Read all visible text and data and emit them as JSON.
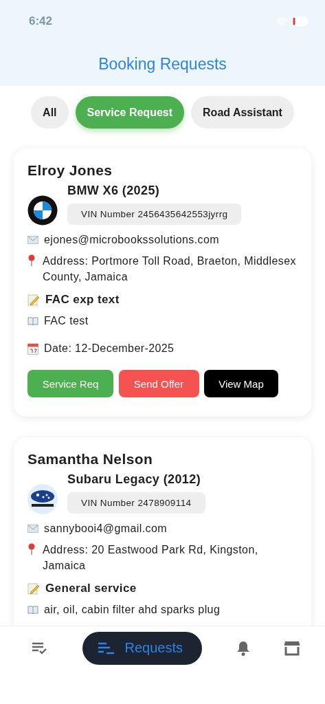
{
  "status_bar": {
    "time": "6:42"
  },
  "header": {
    "title": "Booking Requests"
  },
  "filters": [
    {
      "label": "All",
      "selected": false
    },
    {
      "label": "Service Request",
      "selected": true
    },
    {
      "label": "Road Assistant",
      "selected": false
    }
  ],
  "bookings": [
    {
      "name": "Elroy Jones",
      "vehicle": "BMW X6 (2025)",
      "logo": {
        "kind": "roundel"
      },
      "vin": "VIN Number 2456435642553jyrrg",
      "email": "ejones@microbookssolutions.com",
      "address": "Address: Portmore Toll Road, Braeton, Middlesex County, Jamaica",
      "service": "FAC exp text",
      "description": "FAC test",
      "date": "Date: 12-December-2025",
      "actions": [
        {
          "kind": "service",
          "label": "Service Req"
        },
        {
          "kind": "offer",
          "label": "Send Offer"
        },
        {
          "kind": "map",
          "label": "View Map"
        }
      ]
    },
    {
      "name": "Samantha Nelson",
      "vehicle": "Subaru Legacy (2012)",
      "logo": {
        "kind": "stars"
      },
      "vin": "VIN Number 2478909114",
      "email": "sannybooi4@gmail.com",
      "address": "Address: 20 Eastwood Park Rd, Kingston, Jamaica",
      "service": "General service",
      "description": "air, oil, cabin filter ahd sparks plug"
    }
  ],
  "nav": [
    {
      "kind": "tasks",
      "selected": false
    },
    {
      "kind": "requests",
      "label": "Requests",
      "selected": true
    },
    {
      "kind": "alerts",
      "selected": false
    },
    {
      "kind": "store",
      "selected": false
    }
  ]
}
